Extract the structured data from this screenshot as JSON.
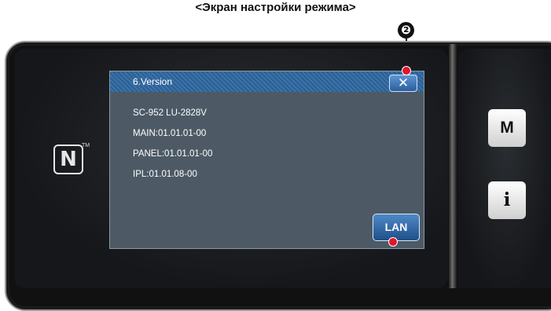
{
  "caption": "<Экран настройки режима>",
  "callout": {
    "number": "❷"
  },
  "nfc": {
    "logo": "N",
    "trademark": "TM"
  },
  "dialog": {
    "title": "6.Version",
    "close_label": "✕",
    "lines": [
      "SC-952 LU-2828V",
      "MAIN:01.01.01-00",
      "PANEL:01.01.01-00",
      "IPL:01.01.08-00"
    ],
    "lan_label": "LAN"
  },
  "side_buttons": {
    "m_label": "M",
    "info_label": "i"
  },
  "colors": {
    "titlebar": "#3b73aa",
    "dialog_bg": "#4d5a66",
    "marker": "#e0162b"
  }
}
